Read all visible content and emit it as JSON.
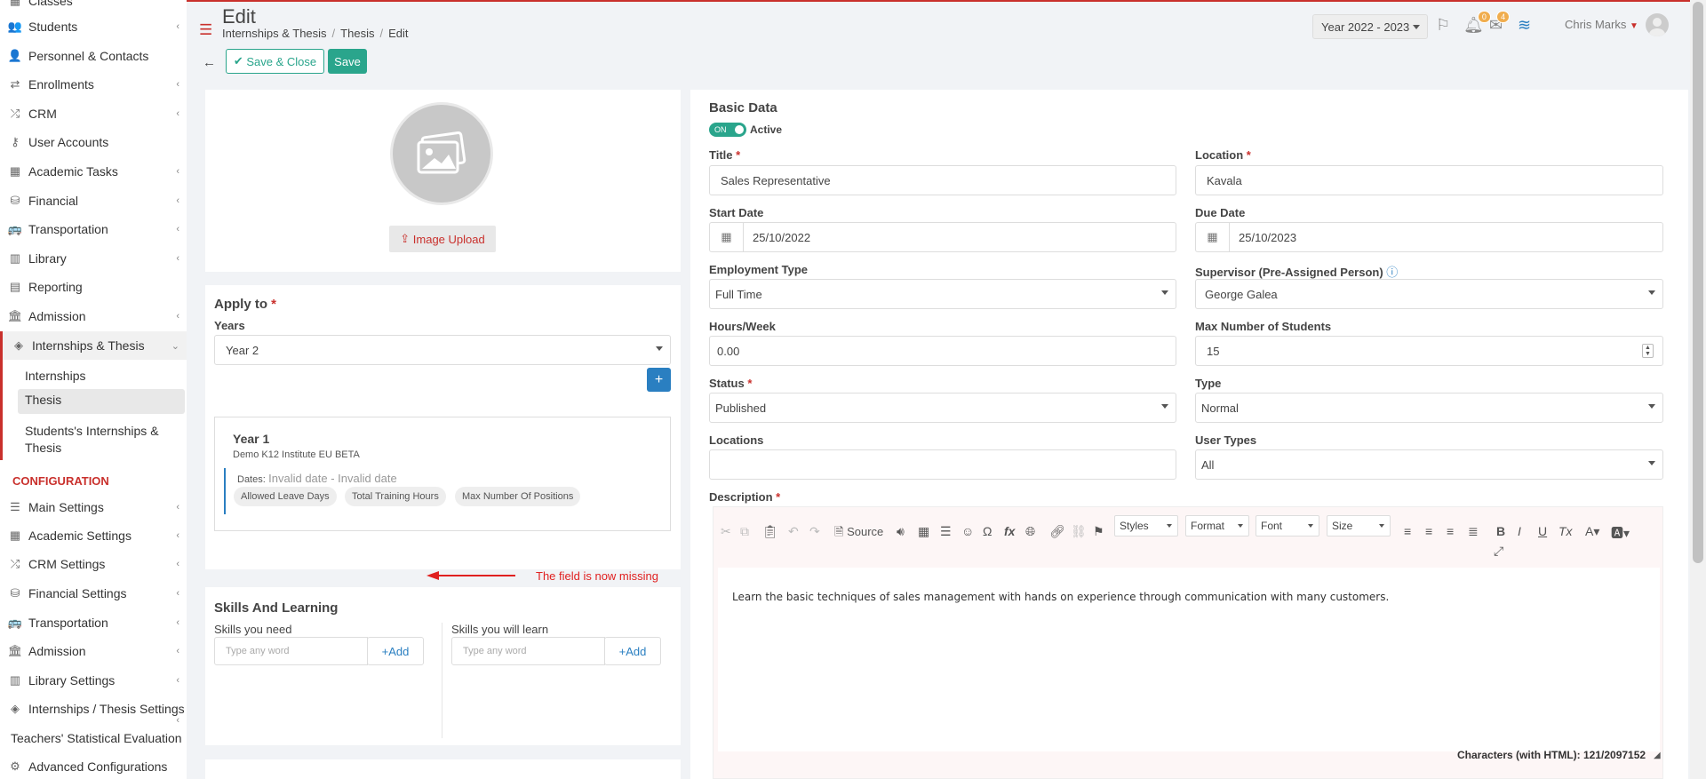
{
  "sidebar": {
    "items": [
      {
        "label": "Classes",
        "icon": "classes-icon",
        "chevron": false
      },
      {
        "label": "Students",
        "icon": "students-icon",
        "chevron": true
      },
      {
        "label": "Personnel & Contacts",
        "icon": "personnel-icon",
        "chevron": false
      },
      {
        "label": "Enrollments",
        "icon": "enrollments-icon",
        "chevron": true
      },
      {
        "label": "CRM",
        "icon": "crm-icon",
        "chevron": true
      },
      {
        "label": "User Accounts",
        "icon": "key-icon",
        "chevron": false
      },
      {
        "label": "Academic Tasks",
        "icon": "grid-icon",
        "chevron": true
      },
      {
        "label": "Financial",
        "icon": "coins-icon",
        "chevron": true
      },
      {
        "label": "Transportation",
        "icon": "bus-icon",
        "chevron": true
      },
      {
        "label": "Library",
        "icon": "books-icon",
        "chevron": true
      },
      {
        "label": "Reporting",
        "icon": "report-icon",
        "chevron": false
      },
      {
        "label": "Admission",
        "icon": "bank-icon",
        "chevron": true
      },
      {
        "label": "Internships & Thesis",
        "icon": "cube-icon",
        "chevron": true
      }
    ],
    "subitems": [
      "Internships",
      "Thesis",
      "Students's Internships & Thesis"
    ],
    "section_title": "CONFIGURATION",
    "config_items": [
      {
        "label": "Main Settings",
        "icon": "sliders-icon",
        "chevron": true
      },
      {
        "label": "Academic Settings",
        "icon": "grid-icon",
        "chevron": true
      },
      {
        "label": "CRM Settings",
        "icon": "crm-icon",
        "chevron": true
      },
      {
        "label": "Financial Settings",
        "icon": "coins-icon",
        "chevron": true
      },
      {
        "label": "Transportation",
        "icon": "bus-icon",
        "chevron": true
      },
      {
        "label": "Admission",
        "icon": "bank-icon",
        "chevron": true
      },
      {
        "label": "Library Settings",
        "icon": "books-icon",
        "chevron": true
      },
      {
        "label": "Internships / Thesis Settings",
        "icon": "cube-icon",
        "chevron": true
      },
      {
        "label": "Teachers' Statistical Evaluation",
        "icon": "",
        "chevron": false
      },
      {
        "label": "Advanced Configurations",
        "icon": "gears-icon",
        "chevron": false
      }
    ]
  },
  "header": {
    "title": "Edit",
    "breadcrumb": [
      "Internships & Thesis",
      "Thesis",
      "Edit"
    ],
    "year_selector": "Year 2022 - 2023",
    "flag_icon": "flag-icon",
    "notifications_count": "0",
    "messages_count": "4",
    "user_name": "Chris Marks"
  },
  "toolbar": {
    "save_close_label": "Save & Close",
    "save_label": "Save"
  },
  "left": {
    "image_upload_label": "Image Upload",
    "apply_to_title": "Apply to",
    "years_label": "Years",
    "years_value": "Year 2",
    "plus_label": "+",
    "year_card": {
      "title": "Year 1",
      "institute": "Demo K12 Institute EU BETA",
      "dates_label": "Dates:",
      "dates_value": "Invalid date - Invalid date",
      "pills": [
        "Allowed Leave Days",
        "Total Training Hours",
        "Max Number Of Positions"
      ]
    },
    "annotation": "The field is now missing",
    "skills_title": "Skills And Learning",
    "skills_need_label": "Skills you need",
    "skills_learn_label": "Skills you will learn",
    "skills_placeholder": "Type any word",
    "add_label": "Add"
  },
  "basic": {
    "title": "Basic Data",
    "toggle_on": "ON",
    "active_label": "Active",
    "fields": {
      "title_label": "Title",
      "title_value": "Sales Representative",
      "location_label": "Location",
      "location_value": "Kavala",
      "start_label": "Start Date",
      "start_value": "25/10/2022",
      "due_label": "Due Date",
      "due_value": "25/10/2023",
      "employment_label": "Employment Type",
      "employment_value": "Full Time",
      "supervisor_label": "Supervisor (Pre-Assigned Person)",
      "supervisor_value": "George Galea",
      "hours_label": "Hours/Week",
      "hours_value": "0.00",
      "max_label": "Max Number of Students",
      "max_value": "15",
      "status_label": "Status",
      "status_value": "Published",
      "type_label": "Type",
      "type_value": "Normal",
      "locations_label": "Locations",
      "locations_value": "",
      "usertypes_label": "User Types",
      "usertypes_value": "All"
    },
    "description_label": "Description",
    "editor": {
      "source_label": "Source",
      "styles_label": "Styles",
      "format_label": "Format",
      "font_label": "Font",
      "size_label": "Size",
      "content": "Learn the basic techniques of sales management with hands on experience through communication with many customers.",
      "char_count": "Characters (with HTML): 121/2097152"
    }
  },
  "colors": {
    "accent": "#2aa58c",
    "brand_red": "#c9302c",
    "link_blue": "#2a7fc1"
  }
}
